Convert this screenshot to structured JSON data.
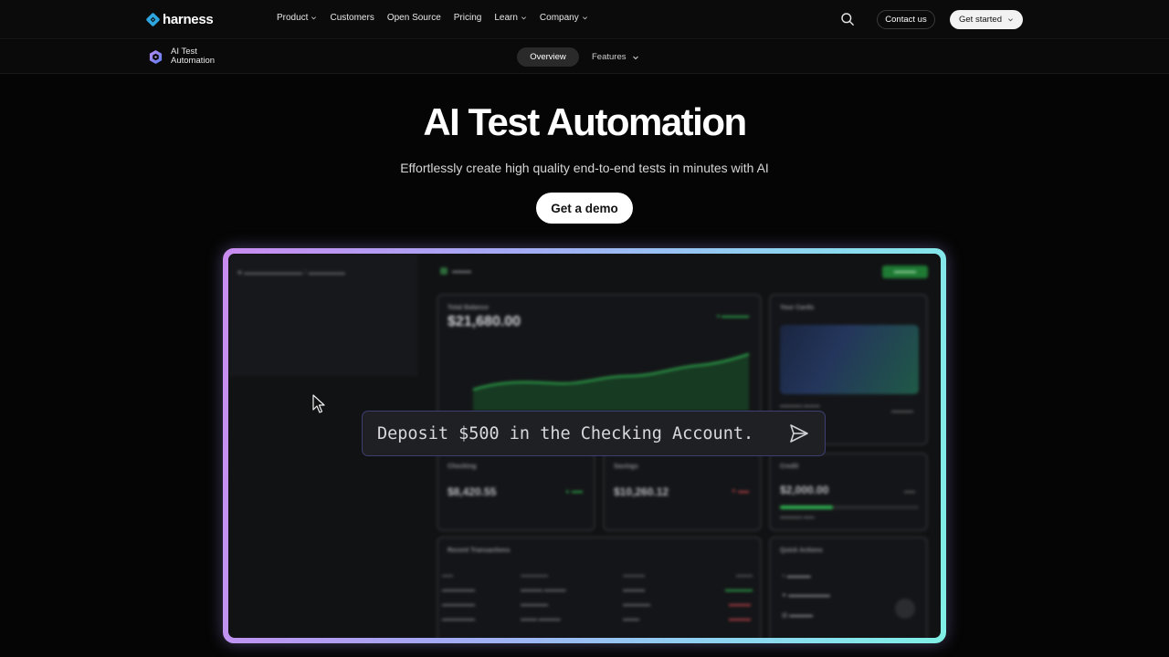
{
  "topnav": {
    "brand": "harness",
    "links": [
      {
        "label": "Product",
        "dropdown": true
      },
      {
        "label": "Customers",
        "dropdown": false
      },
      {
        "label": "Open Source",
        "dropdown": false
      },
      {
        "label": "Pricing",
        "dropdown": false
      },
      {
        "label": "Learn",
        "dropdown": true
      },
      {
        "label": "Company",
        "dropdown": true
      }
    ],
    "contact_label": "Contact us",
    "get_started_label": "Get started"
  },
  "subnav": {
    "product_name": "AI Test Automation",
    "tabs": [
      {
        "label": "Overview",
        "active": true
      },
      {
        "label": "Features",
        "active": false
      }
    ]
  },
  "hero": {
    "title": "AI Test Automation",
    "subtitle": "Effortlessly create high quality end-to-end tests in minutes with AI",
    "cta_label": "Get a demo"
  },
  "demo": {
    "prompt_value": "Deposit $500 in the Checking Account.",
    "app": {
      "total_balance_title": "Total Balance",
      "total_balance_value": "$21,680.00",
      "cards_title": "Your Cards",
      "accounts": [
        {
          "title": "Checking",
          "value": "$8,420.55"
        },
        {
          "title": "Savings",
          "value": "$10,260.12"
        },
        {
          "title": "Credit",
          "value": "$2,000.00"
        }
      ],
      "recent_transactions_title": "Recent Transactions",
      "quick_actions_title": "Quick Actions"
    }
  },
  "colors": {
    "frame_gradient_start": "#c98cf0",
    "frame_gradient_end": "#7ff0e6",
    "accent_green": "#2fb04f"
  }
}
